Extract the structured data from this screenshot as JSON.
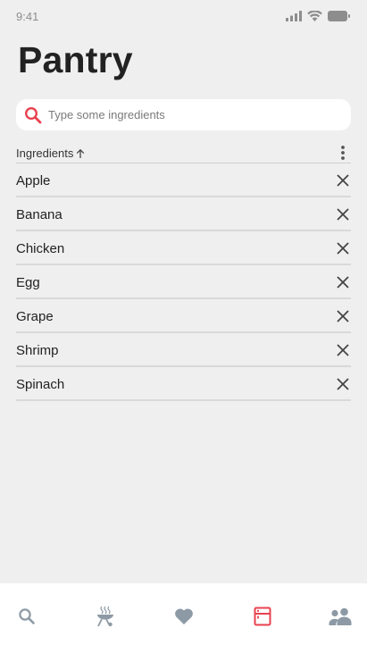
{
  "status_bar": {
    "time": "9:41",
    "icons": [
      "cellular-signal-icon",
      "wifi-icon",
      "battery-icon"
    ]
  },
  "page": {
    "title": "Pantry"
  },
  "search": {
    "placeholder": "Type some ingredients",
    "value": "",
    "icon": "search-icon"
  },
  "list_header": {
    "label": "Ingredients",
    "sort_icon": "arrow-up-icon",
    "sort_direction": "ascending",
    "menu_icon": "more-vertical-icon"
  },
  "ingredients": [
    {
      "name": "Apple"
    },
    {
      "name": "Banana"
    },
    {
      "name": "Chicken"
    },
    {
      "name": "Egg"
    },
    {
      "name": "Grape"
    },
    {
      "name": "Shrimp"
    },
    {
      "name": "Spinach"
    }
  ],
  "tab_bar": {
    "tabs": [
      {
        "icon": "search-icon",
        "active": false
      },
      {
        "icon": "grill-icon",
        "active": false
      },
      {
        "icon": "heart-icon",
        "active": false
      },
      {
        "icon": "fridge-icon",
        "active": true
      },
      {
        "icon": "people-icon",
        "active": false
      }
    ]
  },
  "colors": {
    "accent": "#e8424f",
    "tab_inactive": "#8d9aa5",
    "background": "#efefef",
    "text": "#222222",
    "status": "#8d8d8d"
  }
}
